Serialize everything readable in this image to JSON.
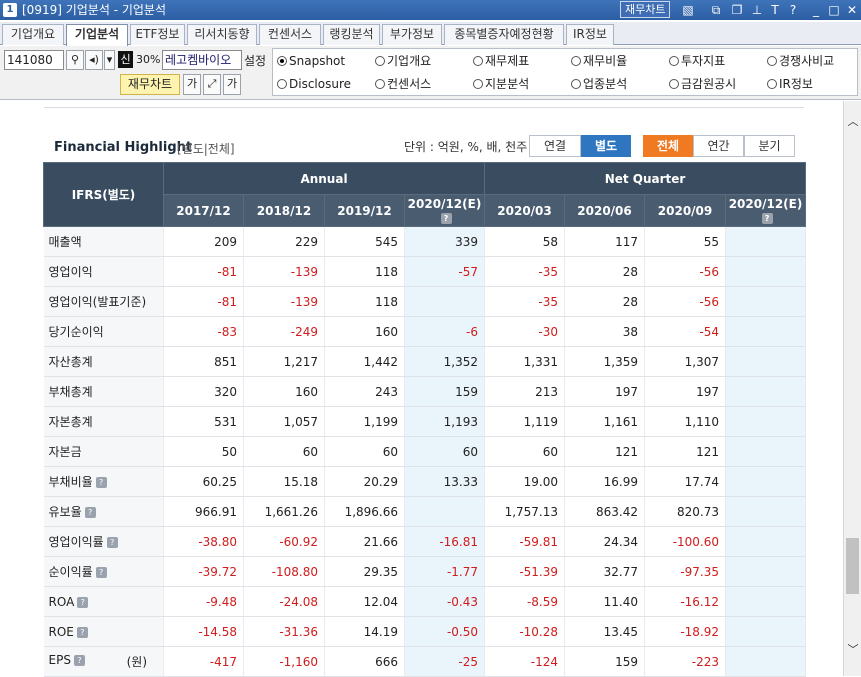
{
  "window": {
    "number": "1",
    "title": "[0919] 기업분석 - 기업분석",
    "chart_button": "재무차트"
  },
  "tabs": [
    "기업개요",
    "기업분석",
    "ETF정보",
    "리서치동향",
    "컨센서스",
    "랭킹분석",
    "부가정보",
    "종목별증자예정현황",
    "IR정보"
  ],
  "toolbar": {
    "code": "141080",
    "shin": "신",
    "percent": "30%",
    "company": "레고켐바이오",
    "setting": "설정",
    "chart_button": "재무차트",
    "small_btn1": "가",
    "small_btn2": "가"
  },
  "radios": [
    {
      "label": "Snapshot",
      "checked": true
    },
    {
      "label": "기업개요",
      "checked": false
    },
    {
      "label": "재무제표",
      "checked": false
    },
    {
      "label": "재무비율",
      "checked": false
    },
    {
      "label": "투자지표",
      "checked": false
    },
    {
      "label": "경쟁사비교",
      "checked": false
    },
    {
      "label": "Disclosure",
      "checked": false
    },
    {
      "label": "컨센서스",
      "checked": false
    },
    {
      "label": "지분분석",
      "checked": false
    },
    {
      "label": "업종분석",
      "checked": false
    },
    {
      "label": "금감원공시",
      "checked": false
    },
    {
      "label": "IR정보",
      "checked": false
    }
  ],
  "highlight": {
    "title": "Financial Highlight",
    "subtitle": "[별도|전체]",
    "unit": "단위 : 억원, %, 배, 천주",
    "toggle1": [
      "연결",
      "별도"
    ],
    "toggle2": [
      "전체",
      "연간",
      "분기"
    ],
    "header": {
      "ifrs": "IFRS(별도)",
      "annual": "Annual",
      "quarter": "Net Quarter",
      "columns": [
        "2017/12",
        "2018/12",
        "2019/12",
        "2020/12(E)",
        "2020/03",
        "2020/06",
        "2020/09",
        "2020/12(E)"
      ]
    },
    "rows": [
      {
        "label": "매출액",
        "values": [
          "209",
          "229",
          "545",
          "339",
          "58",
          "117",
          "55",
          ""
        ]
      },
      {
        "label": "영업이익",
        "values": [
          "-81",
          "-139",
          "118",
          "-57",
          "-35",
          "28",
          "-56",
          ""
        ]
      },
      {
        "label": "영업이익(발표기준)",
        "values": [
          "-81",
          "-139",
          "118",
          "",
          "-35",
          "28",
          "-56",
          ""
        ]
      },
      {
        "label": "당기순이익",
        "values": [
          "-83",
          "-249",
          "160",
          "-6",
          "-30",
          "38",
          "-54",
          ""
        ]
      },
      {
        "label": "자산총계",
        "values": [
          "851",
          "1,217",
          "1,442",
          "1,352",
          "1,331",
          "1,359",
          "1,307",
          ""
        ]
      },
      {
        "label": "부채총계",
        "values": [
          "320",
          "160",
          "243",
          "159",
          "213",
          "197",
          "197",
          ""
        ]
      },
      {
        "label": "자본총계",
        "values": [
          "531",
          "1,057",
          "1,199",
          "1,193",
          "1,119",
          "1,161",
          "1,110",
          ""
        ]
      },
      {
        "label": "자본금",
        "values": [
          "50",
          "60",
          "60",
          "60",
          "60",
          "121",
          "121",
          ""
        ]
      },
      {
        "label": "부채비율",
        "values": [
          "60.25",
          "15.18",
          "20.29",
          "13.33",
          "19.00",
          "16.99",
          "17.74",
          ""
        ]
      },
      {
        "label": "유보율",
        "values": [
          "966.91",
          "1,661.26",
          "1,896.66",
          "",
          "1,757.13",
          "863.42",
          "820.73",
          ""
        ]
      },
      {
        "label": "영업이익률",
        "values": [
          "-38.80",
          "-60.92",
          "21.66",
          "-16.81",
          "-59.81",
          "24.34",
          "-100.60",
          ""
        ]
      },
      {
        "label": "순이익률",
        "values": [
          "-39.72",
          "-108.80",
          "29.35",
          "-1.77",
          "-51.39",
          "32.77",
          "-97.35",
          ""
        ]
      },
      {
        "label": "ROA",
        "values": [
          "-9.48",
          "-24.08",
          "12.04",
          "-0.43",
          "-8.59",
          "11.40",
          "-16.12",
          ""
        ]
      },
      {
        "label": "ROE",
        "values": [
          "-14.58",
          "-31.36",
          "14.19",
          "-0.50",
          "-10.28",
          "13.45",
          "-18.92",
          ""
        ]
      },
      {
        "label": "EPS",
        "unit": "(원)",
        "values": [
          "-417",
          "-1,160",
          "666",
          "-25",
          "-124",
          "159",
          "-223",
          ""
        ]
      }
    ]
  },
  "colors": {
    "negative": "#d01c1c",
    "header": "#3a4c5f",
    "estimate_bg": "#eaf4fb",
    "active_blue": "#2f76c0",
    "active_orange": "#ef7a22"
  }
}
